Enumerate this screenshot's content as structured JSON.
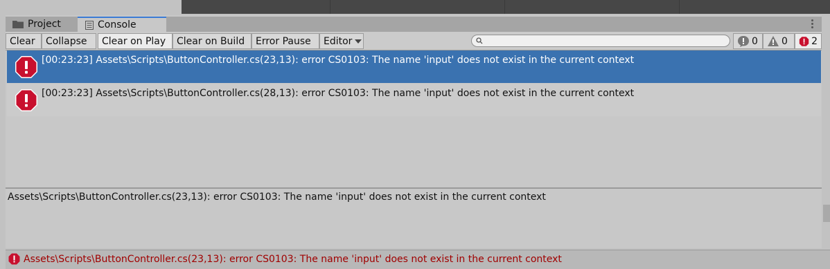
{
  "tabs": [
    {
      "label": "Project",
      "icon": "folder-icon"
    },
    {
      "label": "Console",
      "icon": "console-icon"
    }
  ],
  "toolbar": {
    "clear": "Clear",
    "collapse": "Collapse",
    "clear_on_play": "Clear on Play",
    "clear_on_build": "Clear on Build",
    "error_pause": "Error Pause",
    "editor": "Editor",
    "search_placeholder": "",
    "log_count": "0",
    "warning_count": "0",
    "error_count": "2"
  },
  "logs": [
    {
      "message": "[00:23:23] Assets\\Scripts\\ButtonController.cs(23,13): error CS0103: The name 'input' does not exist in the current context",
      "type": "error",
      "selected": true
    },
    {
      "message": "[00:23:23] Assets\\Scripts\\ButtonController.cs(28,13): error CS0103: The name 'input' does not exist in the current context",
      "type": "error",
      "selected": false
    }
  ],
  "detail": "Assets\\Scripts\\ButtonController.cs(23,13): error CS0103: The name 'input' does not exist in the current context",
  "status": "Assets\\Scripts\\ButtonController.cs(23,13): error CS0103: The name 'input' does not exist in the current context",
  "colors": {
    "selection": "#3a72b0",
    "error": "#c8102e",
    "status_text": "#a00000"
  }
}
